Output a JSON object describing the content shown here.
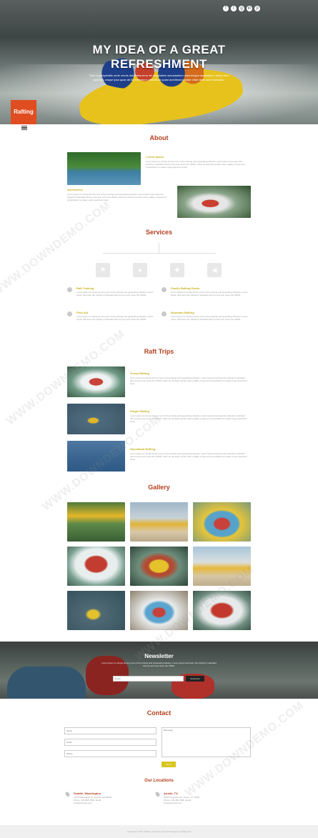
{
  "hero": {
    "title_line1": "MY IDEA OF A GREAT",
    "title_line2": "REFRESHMENT",
    "subtitle": "Sed ut perspiciatis unde omnis iste natus error sit voluptatem accusantium doloremque laudantium, totam rem aperiam, eaque ipsa quae ab illo inventore veritatis et quasi architecto beatae vitae dicta sunt explicabo.",
    "social": [
      "f",
      "t",
      "g",
      "in",
      "p"
    ]
  },
  "logo": "Rafting",
  "about": {
    "title": "About",
    "item1_title": "Lorem Ipsum",
    "item1_text": "Lorem Ipsum is simply dummy text of the printing and typesetting industry. Lorem Ipsum has been the industry's standard dummy text ever since the 1500s, when an unknown printer took a galley of type and scrambled it to make a type specimen book.",
    "item2_title": "Adventures",
    "item2_text": "Lorem Ipsum is simply dummy text of the printing and typesetting industry. Lorem Ipsum has been the industry's standard dummy text ever since the 1500s, when an unknown printer took a galley of type and scrambled it to make a type specimen book."
  },
  "services": {
    "title": "Services",
    "items": [
      {
        "title": "Raft Training",
        "text": "Lorem Ipsum is simply dummy text of the printing and typesetting industry. Lorem Ipsum has been the industry's standard dummy text ever since the 1500s."
      },
      {
        "title": "Family Rafting Packs",
        "text": "Lorem Ipsum is simply dummy text of the printing and typesetting industry. Lorem Ipsum has been the industry's standard dummy text ever since the 1500s."
      },
      {
        "title": "First Aid",
        "text": "Lorem Ipsum is simply dummy text of the printing and typesetting industry. Lorem Ipsum has been the industry's standard dummy text ever since the 1500s."
      },
      {
        "title": "Mountain Rafting",
        "text": "Lorem Ipsum is simply dummy text of the printing and typesetting industry. Lorem Ipsum has been the industry's standard dummy text ever since the 1500s."
      }
    ]
  },
  "trips": {
    "title": "Raft Trips",
    "items": [
      {
        "title": "Group Rafting",
        "text": "Lorem Ipsum is simply dummy text of the printing and typesetting industry. Lorem Ipsum has been the industry's standard dummy text ever since the 1500s, when an unknown printer took a galley of type and scrambled it to make a type specimen book."
      },
      {
        "title": "Single Rafting",
        "text": "Lorem Ipsum is simply dummy text of the printing and typesetting industry. Lorem Ipsum has been the industry's standard dummy text ever since the 1500s, when an unknown printer took a galley of type and scrambled it to make a type specimen book."
      },
      {
        "title": "Speedboat Rafting",
        "text": "Lorem Ipsum is simply dummy text of the printing and typesetting industry. Lorem Ipsum has been the industry's standard dummy text ever since the 1500s, when an unknown printer took a galley of type and scrambled it to make a type specimen book."
      }
    ]
  },
  "gallery": {
    "title": "Gallery"
  },
  "newsletter": {
    "title": "Newsletter",
    "text": "Lorem Ipsum is simply dummy text of the printing and typesetting industry. Lorem Ipsum has been the industry's standard dummy text ever since the 1500s.",
    "email_placeholder": "Email",
    "button": "Subscribe"
  },
  "contact": {
    "title": "Contact",
    "name_placeholder": "Name",
    "email_placeholder": "Email",
    "phone_placeholder": "Phone",
    "message_placeholder": "Message",
    "submit": "Send"
  },
  "locations": {
    "title": "Our Locations",
    "loc1_name": "Seattle, Washington",
    "loc1_text": "1234 Washington St, Seattle, WA 98104. Phone: 123-456-7890. Email: info@example.com",
    "loc2_name": "Austin, TX",
    "loc2_text": "5678 Congress Ave, Austin, TX 78701. Phone: 123-456-7890. Email: info@example.com"
  },
  "footer": "Copyright © 2017 Rafting. All rights reserved | Design by W3layouts",
  "watermark": "WWW.DOWNDEMO.COM"
}
